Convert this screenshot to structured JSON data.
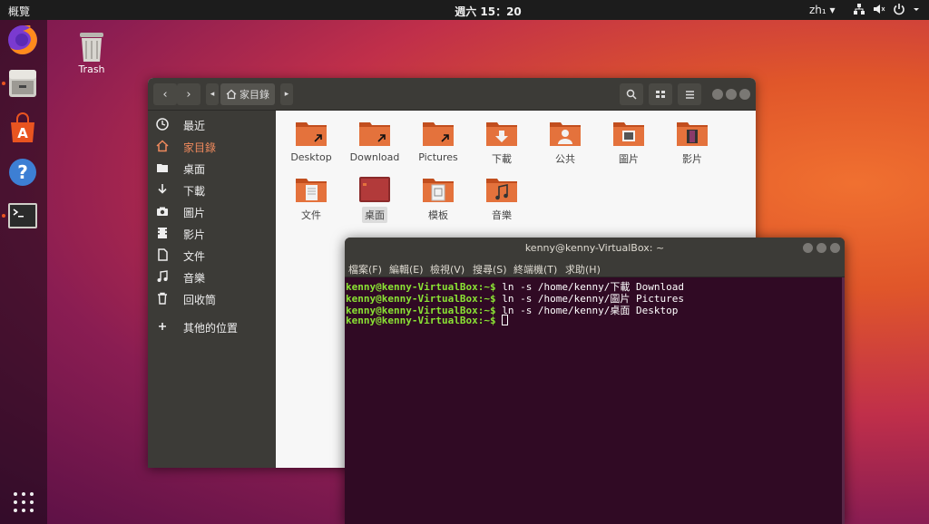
{
  "topbar": {
    "activities": "概覽",
    "clock": "週六 15：20",
    "lang": "zh₁ ▾",
    "icons": [
      "network-icon",
      "volume-icon",
      "power-icon"
    ]
  },
  "dock": {
    "apps": [
      "firefox",
      "files",
      "software",
      "help",
      "terminal"
    ]
  },
  "desktop": {
    "trash": "Trash"
  },
  "nautilus": {
    "path_label": "家目錄",
    "sidebar": [
      "最近",
      "家目錄",
      "桌面",
      "下載",
      "圖片",
      "影片",
      "文件",
      "音樂",
      "回收筒",
      "其他的位置"
    ],
    "folders_row1": [
      "Desktop",
      "Download",
      "Pictures",
      "下載",
      "公共",
      "圖片",
      "影片"
    ],
    "folders_row2": [
      "文件",
      "桌面",
      "模板",
      "音樂"
    ],
    "colors": {
      "accent": "#e95420",
      "folder": "#e4723c"
    }
  },
  "terminal": {
    "title": "kenny@kenny-VirtualBox: ~",
    "menu": [
      "檔案(F)",
      "編輯(E)",
      "檢視(V)",
      "搜尋(S)",
      "終端機(T)",
      "求助(H)"
    ],
    "prompt": "kenny@kenny-VirtualBox:~$",
    "lines": [
      " ln -s /home/kenny/下載 Download",
      " ln -s /home/kenny/圖片 Pictures",
      " ln -s /home/kenny/桌面 Desktop",
      " "
    ]
  }
}
